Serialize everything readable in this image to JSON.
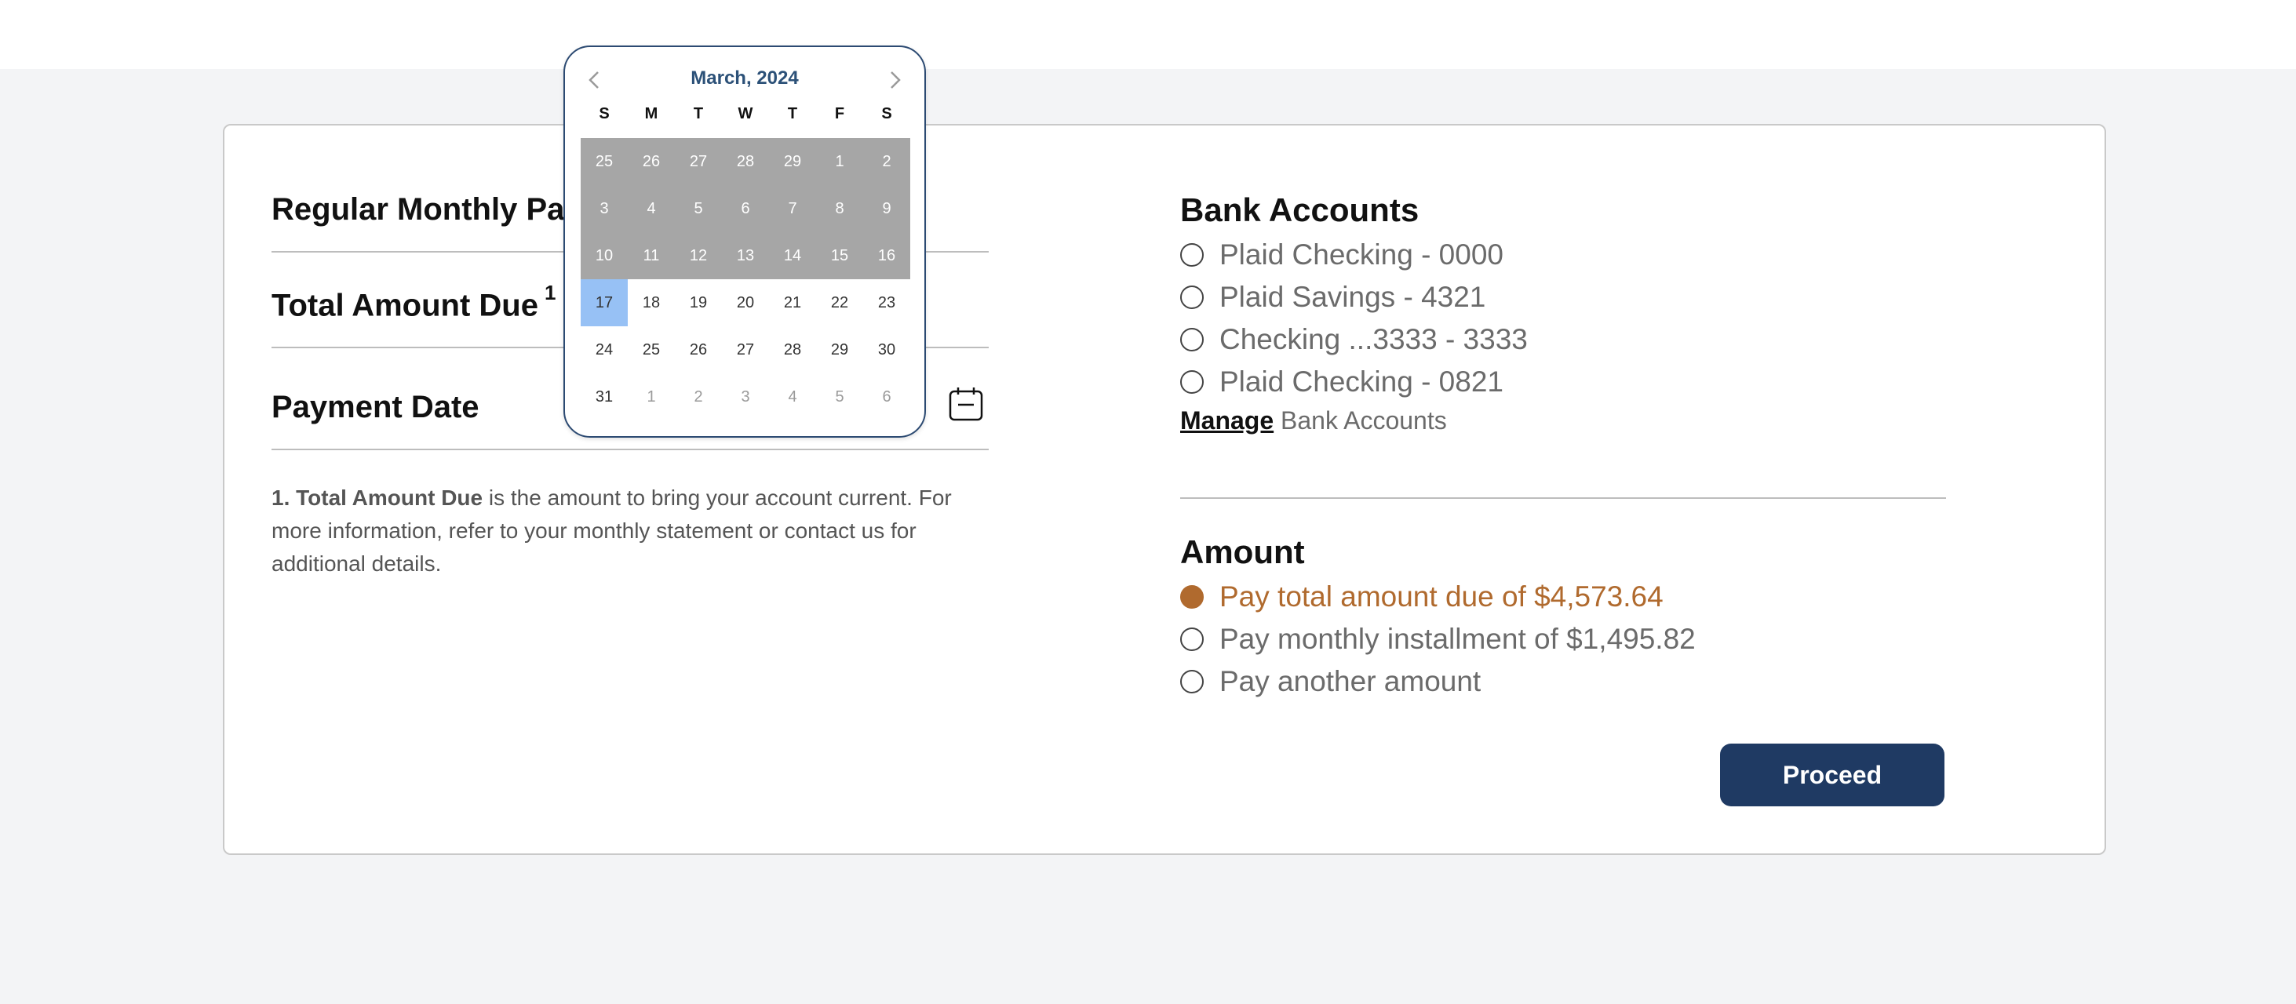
{
  "form": {
    "regular_monthly_label": "Regular Monthly Pay",
    "total_due_label": "Total Amount Due",
    "total_due_footnote_marker": "1",
    "payment_date_label": "Payment Date",
    "footnote": {
      "bold": "1. Total Amount Due",
      "text": " is the amount to bring your account current. For more information, refer to your monthly statement or contact us for additional details."
    }
  },
  "bank_accounts": {
    "title": "Bank Accounts",
    "items": [
      {
        "label": "Plaid Checking - 0000",
        "selected": false
      },
      {
        "label": "Plaid Savings - 4321",
        "selected": false
      },
      {
        "label": "Checking ...3333 - 3333",
        "selected": false
      },
      {
        "label": "Plaid Checking - 0821",
        "selected": false
      }
    ],
    "manage_link": "Manage",
    "manage_suffix": " Bank Accounts"
  },
  "amount": {
    "title": "Amount",
    "items": [
      {
        "label": "Pay total amount due of $4,573.64",
        "selected": true
      },
      {
        "label": "Pay monthly installment of $1,495.82",
        "selected": false
      },
      {
        "label": "Pay another amount",
        "selected": false
      }
    ]
  },
  "proceed_label": "Proceed",
  "calendar": {
    "month_label": "March, 2024",
    "prev_icon": "chevron-left-icon",
    "next_icon": "chevron-right-icon",
    "weekdays": [
      "S",
      "M",
      "T",
      "W",
      "T",
      "F",
      "S"
    ],
    "weeks": [
      [
        {
          "d": "25",
          "s": "disabled"
        },
        {
          "d": "26",
          "s": "disabled"
        },
        {
          "d": "27",
          "s": "disabled"
        },
        {
          "d": "28",
          "s": "disabled"
        },
        {
          "d": "29",
          "s": "disabled"
        },
        {
          "d": "1",
          "s": "disabled"
        },
        {
          "d": "2",
          "s": "disabled"
        }
      ],
      [
        {
          "d": "3",
          "s": "disabled"
        },
        {
          "d": "4",
          "s": "disabled"
        },
        {
          "d": "5",
          "s": "disabled"
        },
        {
          "d": "6",
          "s": "disabled"
        },
        {
          "d": "7",
          "s": "disabled"
        },
        {
          "d": "8",
          "s": "disabled"
        },
        {
          "d": "9",
          "s": "disabled"
        }
      ],
      [
        {
          "d": "10",
          "s": "disabled"
        },
        {
          "d": "11",
          "s": "disabled"
        },
        {
          "d": "12",
          "s": "disabled"
        },
        {
          "d": "13",
          "s": "disabled"
        },
        {
          "d": "14",
          "s": "disabled"
        },
        {
          "d": "15",
          "s": "disabled"
        },
        {
          "d": "16",
          "s": "disabled"
        }
      ],
      [
        {
          "d": "17",
          "s": "today"
        },
        {
          "d": "18",
          "s": "normal"
        },
        {
          "d": "19",
          "s": "normal"
        },
        {
          "d": "20",
          "s": "normal"
        },
        {
          "d": "21",
          "s": "normal"
        },
        {
          "d": "22",
          "s": "normal"
        },
        {
          "d": "23",
          "s": "normal"
        }
      ],
      [
        {
          "d": "24",
          "s": "normal"
        },
        {
          "d": "25",
          "s": "normal"
        },
        {
          "d": "26",
          "s": "normal"
        },
        {
          "d": "27",
          "s": "normal"
        },
        {
          "d": "28",
          "s": "normal"
        },
        {
          "d": "29",
          "s": "normal"
        },
        {
          "d": "30",
          "s": "normal"
        }
      ],
      [
        {
          "d": "31",
          "s": "normal"
        },
        {
          "d": "1",
          "s": "outside"
        },
        {
          "d": "2",
          "s": "outside"
        },
        {
          "d": "3",
          "s": "outside"
        },
        {
          "d": "4",
          "s": "outside"
        },
        {
          "d": "5",
          "s": "outside"
        },
        {
          "d": "6",
          "s": "outside"
        }
      ]
    ]
  },
  "colors": {
    "primary_button": "#1f3a63",
    "accent_selected": "#b06a2e",
    "calendar_month": "#2c5178",
    "today_highlight": "#97c1f5",
    "disabled_day": "#a6a6a6"
  }
}
